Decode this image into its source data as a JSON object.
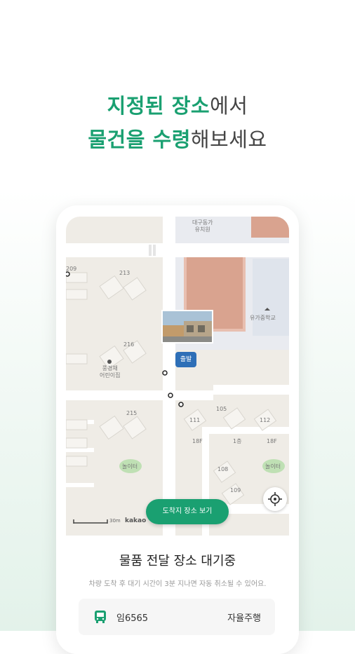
{
  "headline": {
    "line1_accent": "지정된 장소",
    "line1_rest": "에서",
    "line2_accent": "물건을 수령",
    "line2_rest": "해보세요"
  },
  "map": {
    "labels": {
      "kindergarten": "대구동가\n유치원",
      "school": "유가중학교",
      "daycare": "풍경채\n어린이집",
      "play1": "놀이터",
      "play2": "놀이터",
      "b213": "213",
      "b216": "216",
      "b215": "215",
      "b108": "108",
      "b109": "109",
      "b111": "111",
      "b112": "112",
      "b105": "105",
      "b209": "209",
      "s1f": "1층",
      "s18f": "18F",
      "s18f2": "18F"
    },
    "depart_badge": "출발",
    "dest_button": "도착지 장소 보기",
    "scale": "30m",
    "brand": "kakao",
    "icons": [
      "locate-icon",
      "school-icon",
      "daycare-icon",
      "pin-icon"
    ]
  },
  "sheet": {
    "title": "물품 전달 장소 대기중",
    "subtitle": "차량 도착 후 대기 시간이 3분 지나면 자동 취소될 수 있어요.",
    "bus_number": "임6565",
    "bus_status": "자율주행"
  },
  "colors": {
    "accent": "#1aa071",
    "badge": "#2e6fb7"
  }
}
